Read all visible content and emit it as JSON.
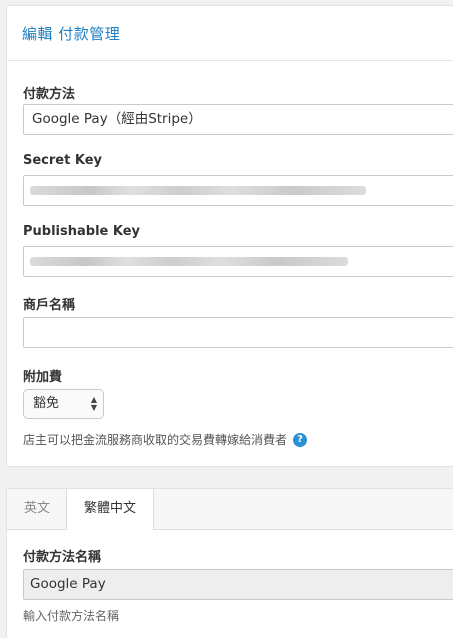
{
  "header": {
    "title": "編輯 付款管理"
  },
  "payment_method": {
    "label": "付款方法",
    "value": "Google Pay（經由Stripe）"
  },
  "secret_key": {
    "label": "Secret Key",
    "value_masked": true
  },
  "publishable_key": {
    "label": "Publishable Key",
    "value_masked": true
  },
  "merchant_name": {
    "label": "商戶名稱",
    "value": ""
  },
  "surcharge": {
    "label": "附加費",
    "value": "豁免",
    "help": "店主可以把金流服務商收取的交易費轉嫁給消費者"
  },
  "tabs": [
    {
      "label": "英文",
      "active": false
    },
    {
      "label": "繁體中文",
      "active": true
    }
  ],
  "display_name": {
    "label": "付款方法名稱",
    "value": "Google Pay",
    "hint": "輸入付款方法名稱"
  },
  "icons": {
    "help": "question-circle-icon",
    "select_arrows": "updown-arrows-icon"
  },
  "colors": {
    "accent": "#1d7fc6",
    "help_icon": "#2d8fd6"
  }
}
